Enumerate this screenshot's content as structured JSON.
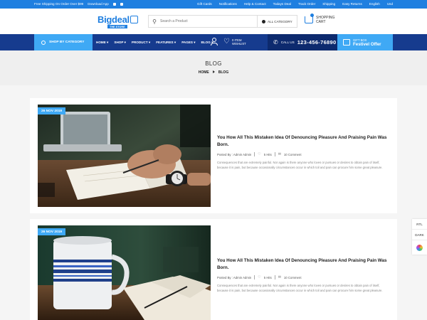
{
  "topbar": {
    "shipping": "Free Shipping On Order Over $99",
    "download": "Download App",
    "links": [
      "Gift Cards",
      "Notifications",
      "Help & Contact",
      "Todays Deal",
      "Track Order",
      "Shipping",
      "Easy Returns",
      "English",
      "Usd"
    ]
  },
  "header": {
    "logo_text": "Bigdeal",
    "logo_tagline": "THE STORE",
    "search_placeholder": "Search a Product",
    "category": "ALL CATEGORY",
    "cart_line1": "SHOPPING",
    "cart_line2": "CART"
  },
  "nav": {
    "shop_by_category": "SHOP BY CATEGORY",
    "menu": [
      "HOME ▾",
      "SHOP ▾",
      "PRODUCT ▾",
      "FEATURES ▾",
      "PAGES ▾",
      "BLOG ▾"
    ],
    "wishlist_count": "0 ITEM",
    "wishlist_label": "WISHLIST",
    "call_label": "CALL US",
    "phone": "123-456-76890",
    "gift_line1": "GIFT BOX",
    "gift_line2": "Festivel Offer"
  },
  "banner": {
    "title": "BLOG",
    "crumb_home": "HOME",
    "crumb_current": "BLOG"
  },
  "posts": [
    {
      "date": "26 NOV 2019",
      "title": "You How All This Mistaken Idea Of Denouncing Pleasure And Praising Pain Was Born.",
      "author": "Posted By : Admin Admin",
      "hits": "5 Hits",
      "comments": "10 Comment",
      "excerpt": "Consequences that are extremely painful. Nor again is there anyone who loves or pursues or desires to obtain pain of itself, because it is pain, but because occasionally circumstances occur in which toil and pain can procure him some great pleasure."
    },
    {
      "date": "26 NOV 2019",
      "title": "You How All This Mistaken Idea Of Denouncing Pleasure And Praising Pain Was Born.",
      "author": "Posted By : Admin Admin",
      "hits": "5 Hits",
      "comments": "10 Comment",
      "excerpt": "Consequences that are extremely painful. Nor again is there anyone who loves or pursues or desires to obtain pain of itself, because it is pain, but because occasionally circumstances occur in which toil and pain can procure him some great pleasure."
    }
  ],
  "side": {
    "rtl": "RTL",
    "dark": "DARK"
  },
  "colors": {
    "primary": "#1f7fe0",
    "accent": "#3fa9f5",
    "navy": "#163b8e"
  }
}
